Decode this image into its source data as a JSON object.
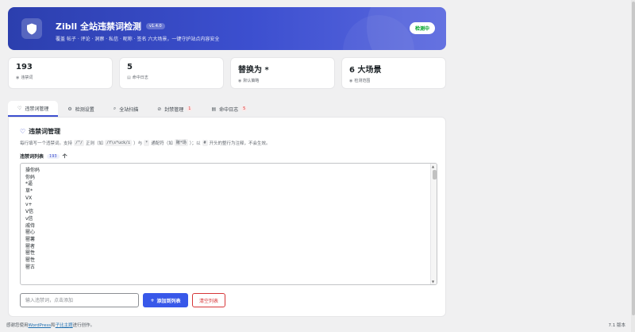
{
  "header": {
    "title": "Zibll 全站违禁词检测",
    "version": "v1.4.0",
    "subtitle": "覆盖 帖子 · 评论 · 洞察 · 私信 · 昵称 · 签名 六大场景，一键守护站点内容安全",
    "status": "检测中"
  },
  "stats": [
    {
      "value": "193",
      "label": "违禁词",
      "icon": "dot-icon"
    },
    {
      "value": "5",
      "label": "命中日志",
      "icon": "list-icon"
    },
    {
      "value": "替换为 *",
      "label": "默认策略",
      "icon": "dot-icon"
    },
    {
      "value": "6 大场景",
      "label": "检测范围",
      "icon": "dot-icon"
    }
  ],
  "tabs": [
    {
      "label": "违禁词管理",
      "icon": "heart-icon",
      "active": true
    },
    {
      "label": "检测设置",
      "icon": "gear-icon"
    },
    {
      "label": "全站扫描",
      "icon": "search-icon"
    },
    {
      "label": "封禁管理",
      "icon": "ban-icon",
      "badge": "1"
    },
    {
      "label": "命中日志",
      "icon": "log-icon",
      "badge": "5"
    }
  ],
  "panel": {
    "title": "违禁词管理",
    "desc": {
      "p1": "每行填写一个违禁词。支持",
      "c1": "/^/",
      "p2": "正则（如",
      "c2": "/f\\s*uck/i",
      "p3": "）与",
      "c3": "*",
      "p4": "通配符（如",
      "c4": "赌*场",
      "p5": "）；以",
      "c5": "#",
      "p6": "开头的整行为注释，不会生效。"
    },
    "list_label": "违禁词列表",
    "count": "193",
    "count_suffix": "个",
    "words": [
      "操你妈",
      "你妈",
      "*逼",
      "草*",
      "VX",
      "v+",
      "V信",
      "v信",
      "戚侍",
      "罂心",
      "罂薯",
      "罂者",
      "罂性",
      "罂性",
      "罂古"
    ],
    "input_placeholder": "输入违禁词，点击添加",
    "add_label": "添加到列表",
    "clear_label": "清空列表"
  },
  "footer": {
    "left_prefix": "感谢您使用",
    "link1": "WordPress",
    "middle": "和",
    "link2": "子比主题",
    "suffix": "进行创作。",
    "right": "7.1 版本"
  }
}
